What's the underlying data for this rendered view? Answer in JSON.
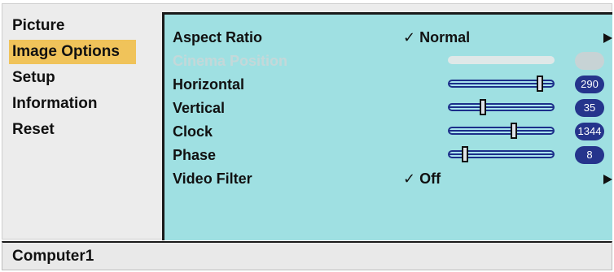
{
  "menu": {
    "items": [
      {
        "label": "Picture",
        "active": false
      },
      {
        "label": "Image Options",
        "active": true
      },
      {
        "label": "Setup",
        "active": false
      },
      {
        "label": "Information",
        "active": false
      },
      {
        "label": "Reset",
        "active": false
      }
    ]
  },
  "panel": {
    "rows": [
      {
        "label": "Aspect Ratio",
        "value": "✓ Normal",
        "has_arrow": true
      },
      {
        "label": "Cinema Position",
        "disabled": true
      },
      {
        "label": "Horizontal",
        "display": "290",
        "level": 0.9
      },
      {
        "label": "Vertical",
        "display": "35",
        "level": 0.31
      },
      {
        "label": "Clock",
        "display": "1344",
        "level": 0.63
      },
      {
        "label": "Phase",
        "display": "8",
        "level": 0.13
      },
      {
        "label": "Video Filter",
        "value": "✓ Off",
        "has_arrow": true
      }
    ]
  },
  "status": {
    "source": "Computer1"
  },
  "colors": {
    "active_highlight": "#f0c35a",
    "panel_bg": "#9fe0e2",
    "badge_bg": "#25348c",
    "slider_color": "#1c2f8a"
  }
}
